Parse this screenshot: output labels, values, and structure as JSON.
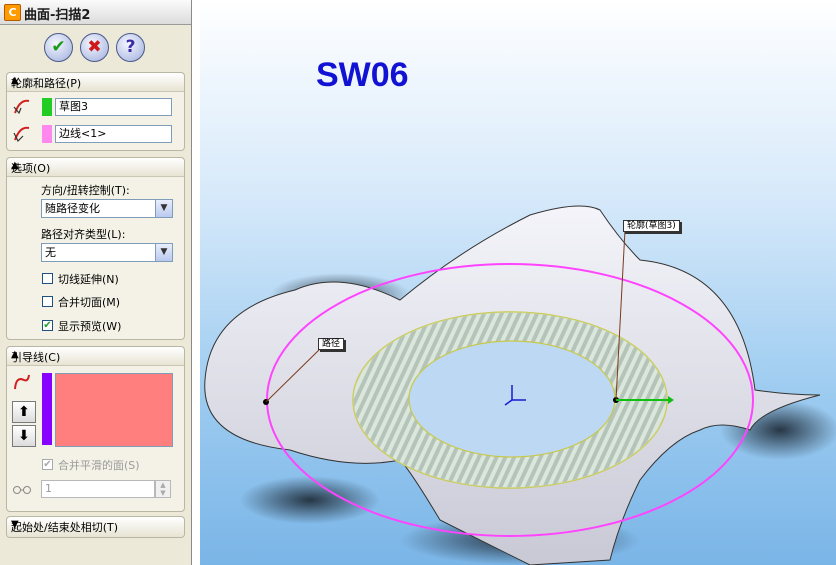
{
  "window": {
    "title": "曲面-扫描2",
    "title_icon": "C"
  },
  "actions": {
    "ok_icon": "✔",
    "cancel_icon": "✖",
    "help_icon": "?"
  },
  "profile_path": {
    "header": "轮廓和路径(P)",
    "profile_value": "草图3",
    "profile_color": "#22cc22",
    "path_value": "边线<1>",
    "path_color": "#ff88ee"
  },
  "options": {
    "header": "选项(O)",
    "orientation_label": "方向/扭转控制(T):",
    "orientation_value": "随路径变化",
    "alignment_label": "路径对齐类型(L):",
    "alignment_value": "无",
    "checkboxes": [
      {
        "label": "切线延伸(N)",
        "checked": false
      },
      {
        "label": "合并切面(M)",
        "checked": false
      },
      {
        "label": "显示预览(W)",
        "checked": true
      }
    ]
  },
  "guide_curves": {
    "header": "引导线(C)",
    "merge_label": "合并平滑的面(S)",
    "merge_checked": true,
    "value": "1",
    "swatch_color": "#8800ff",
    "list_color": "#ff7f7f"
  },
  "tangency": {
    "header": "起始处/结束处相切(T)"
  },
  "viewport": {
    "watermark": "SW06",
    "callout_path": "路径",
    "callout_profile": "轮廓(草图3)"
  }
}
